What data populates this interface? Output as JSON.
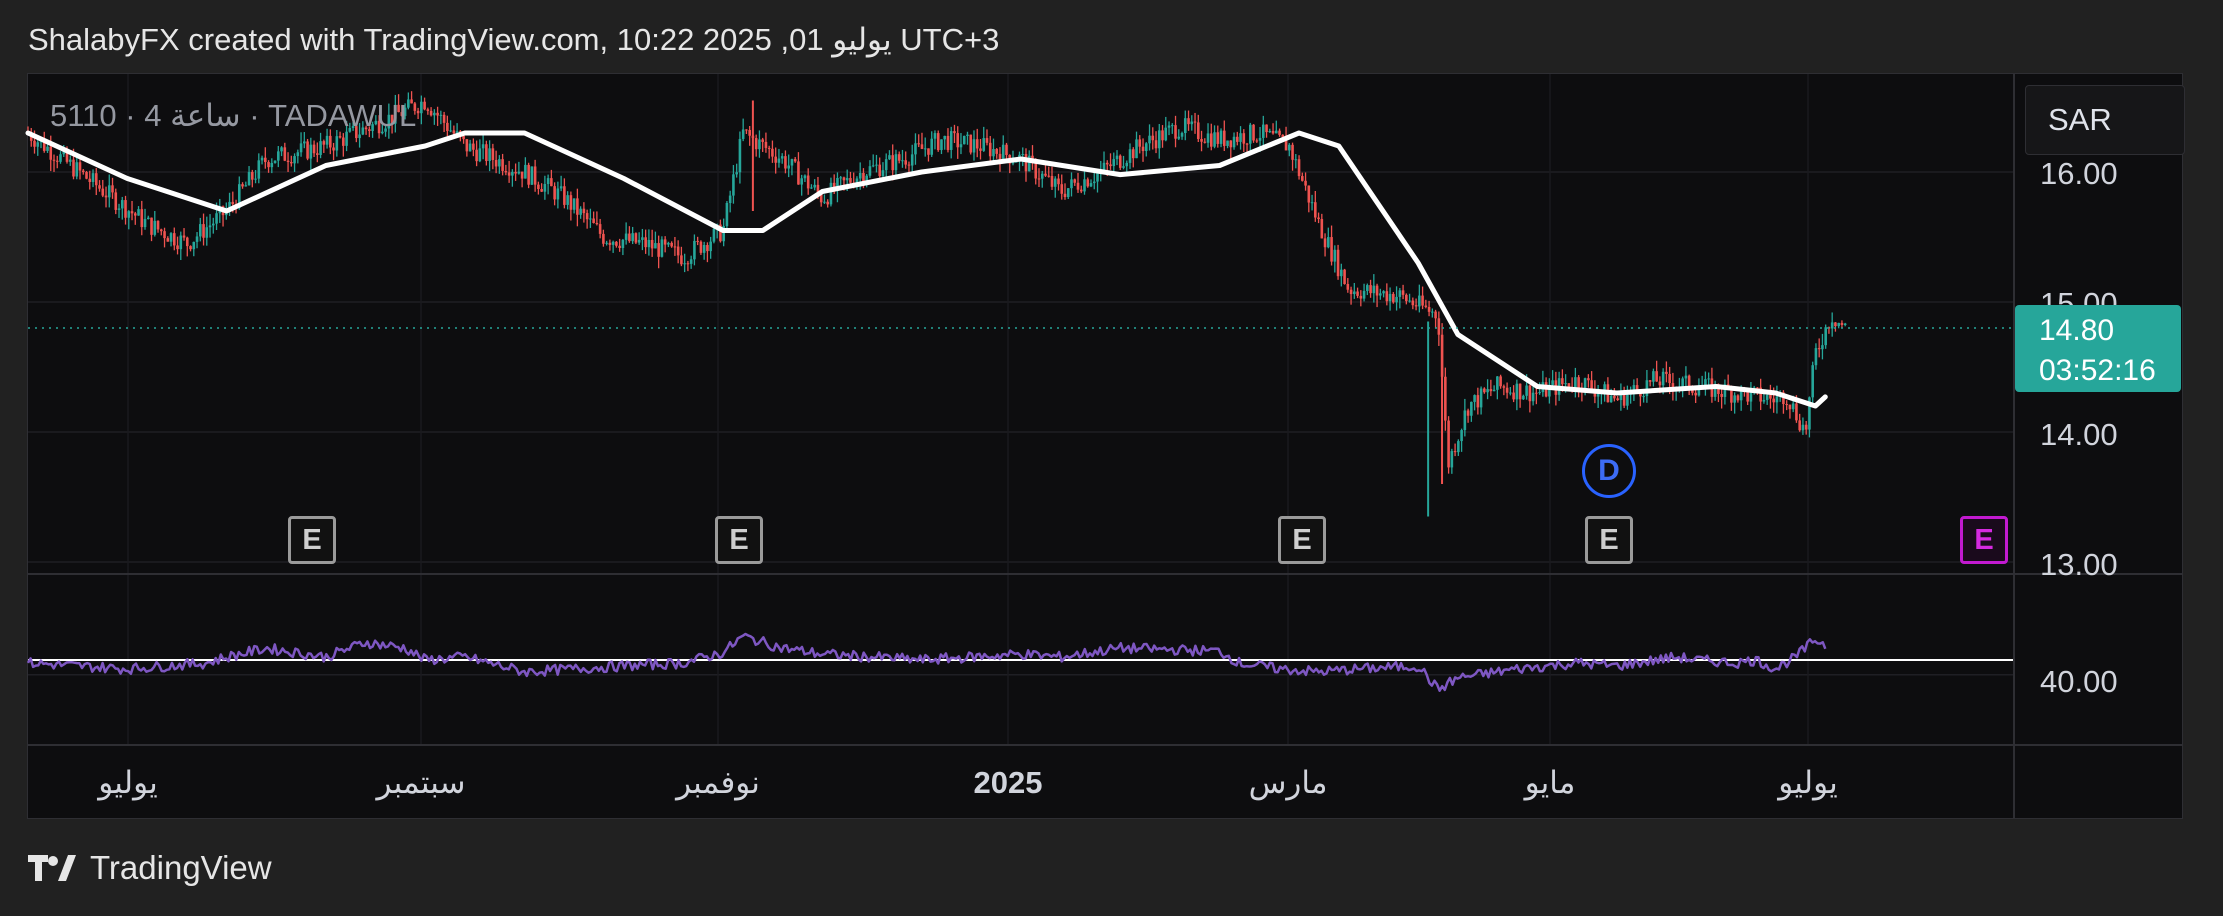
{
  "header": {
    "text": "ShalabyFX created with TradingView.com, 10:22 2025 ,01 يوليو UTC+3"
  },
  "symbol": {
    "text": "5110 · 4 ساعة · TADAWUL"
  },
  "currency": "SAR",
  "price_tag": {
    "price": "14.80",
    "countdown": "03:52:16"
  },
  "price_axis": [
    "16.00",
    "15.00",
    "14.00",
    "13.00"
  ],
  "rsi_axis": [
    "40.00"
  ],
  "time_axis": [
    "يوليو",
    "سبتمبر",
    "نوفمبر",
    "2025",
    "مارس",
    "مايو",
    "يوليو"
  ],
  "events": {
    "earnings_label": "E",
    "dividend_label": "D"
  },
  "footer": {
    "brand": "TradingView"
  },
  "colors": {
    "up": "#26a69a",
    "down": "#ef5350",
    "ma": "#ffffff",
    "rsi": "#7e57c2",
    "accent": "#26a69a"
  },
  "chart_data": [
    {
      "type": "candlestick",
      "title": "5110 · 4 ساعة · TADAWUL",
      "currency": "SAR",
      "last_price": 14.8,
      "ylim": [
        12.9,
        16.5
      ],
      "y_ticks": [
        13.0,
        14.0,
        15.0,
        16.0
      ],
      "x_ticks": [
        "يوليو",
        "سبتمبر",
        "نوفمبر",
        "2025",
        "مارس",
        "مايو",
        "يوليو"
      ],
      "close_path": [
        [
          0,
          16.3
        ],
        [
          0.03,
          15.95
        ],
        [
          0.06,
          15.6
        ],
        [
          0.08,
          15.45
        ],
        [
          0.1,
          15.7
        ],
        [
          0.12,
          16.1
        ],
        [
          0.15,
          16.2
        ],
        [
          0.18,
          16.4
        ],
        [
          0.2,
          16.55
        ],
        [
          0.22,
          16.2
        ],
        [
          0.25,
          16.0
        ],
        [
          0.27,
          15.8
        ],
        [
          0.29,
          15.5
        ],
        [
          0.31,
          15.45
        ],
        [
          0.33,
          15.35
        ],
        [
          0.35,
          15.55
        ],
        [
          0.36,
          16.3
        ],
        [
          0.38,
          16.1
        ],
        [
          0.4,
          15.8
        ],
        [
          0.42,
          16.0
        ],
        [
          0.44,
          16.1
        ],
        [
          0.46,
          16.25
        ],
        [
          0.48,
          16.2
        ],
        [
          0.5,
          16.1
        ],
        [
          0.52,
          15.85
        ],
        [
          0.54,
          16.0
        ],
        [
          0.56,
          16.2
        ],
        [
          0.58,
          16.35
        ],
        [
          0.6,
          16.25
        ],
        [
          0.62,
          16.3
        ],
        [
          0.635,
          16.2
        ],
        [
          0.65,
          15.6
        ],
        [
          0.665,
          15.1
        ],
        [
          0.69,
          15.05
        ],
        [
          0.71,
          14.9
        ],
        [
          0.715,
          13.75
        ],
        [
          0.725,
          14.2
        ],
        [
          0.74,
          14.35
        ],
        [
          0.76,
          14.3
        ],
        [
          0.78,
          14.4
        ],
        [
          0.8,
          14.25
        ],
        [
          0.82,
          14.4
        ],
        [
          0.84,
          14.35
        ],
        [
          0.86,
          14.3
        ],
        [
          0.88,
          14.25
        ],
        [
          0.87,
          14.15
        ],
        [
          0.885,
          14.3
        ],
        [
          0.895,
          14.0
        ],
        [
          0.9,
          14.6
        ],
        [
          0.908,
          14.9
        ],
        [
          0.915,
          14.8
        ]
      ],
      "series": [
        {
          "name": "MA",
          "x": [
            0,
            0.05,
            0.1,
            0.15,
            0.2,
            0.22,
            0.25,
            0.3,
            0.35,
            0.37,
            0.4,
            0.45,
            0.5,
            0.55,
            0.6,
            0.64,
            0.66,
            0.7,
            0.72,
            0.76,
            0.8,
            0.85,
            0.88,
            0.9,
            0.905
          ],
          "values": [
            16.3,
            15.95,
            15.7,
            16.05,
            16.2,
            16.3,
            16.3,
            15.95,
            15.55,
            15.55,
            15.85,
            16.0,
            16.1,
            15.98,
            16.05,
            16.3,
            16.2,
            15.3,
            14.75,
            14.35,
            14.3,
            14.35,
            14.3,
            14.2,
            14.27
          ]
        },
        {
          "name": "RSI",
          "x": [
            0,
            0.05,
            0.09,
            0.1,
            0.12,
            0.15,
            0.17,
            0.19,
            0.2,
            0.22,
            0.25,
            0.3,
            0.33,
            0.35,
            0.36,
            0.38,
            0.4,
            0.45,
            0.5,
            0.52,
            0.55,
            0.6,
            0.61,
            0.63,
            0.65,
            0.67,
            0.7,
            0.71,
            0.72,
            0.75,
            0.78,
            0.8,
            0.83,
            0.84,
            0.86,
            0.87,
            0.88,
            0.89,
            0.9,
            0.905
          ],
          "values": [
            48,
            44,
            48,
            52,
            58,
            52,
            62,
            58,
            50,
            52,
            42,
            46,
            48,
            55,
            66,
            58,
            54,
            50,
            54,
            52,
            58,
            56,
            48,
            44,
            42,
            44,
            46,
            30,
            38,
            44,
            48,
            46,
            52,
            50,
            48,
            50,
            44,
            52,
            64,
            60
          ]
        }
      ],
      "events": [
        {
          "type": "earnings",
          "x": 0.142
        },
        {
          "type": "earnings",
          "x": 0.357
        },
        {
          "type": "earnings",
          "x": 0.639
        },
        {
          "type": "earnings",
          "x": 0.792
        },
        {
          "type": "dividend",
          "x": 0.792
        },
        {
          "type": "earnings",
          "x": 0.977,
          "upcoming": true
        }
      ]
    }
  ]
}
